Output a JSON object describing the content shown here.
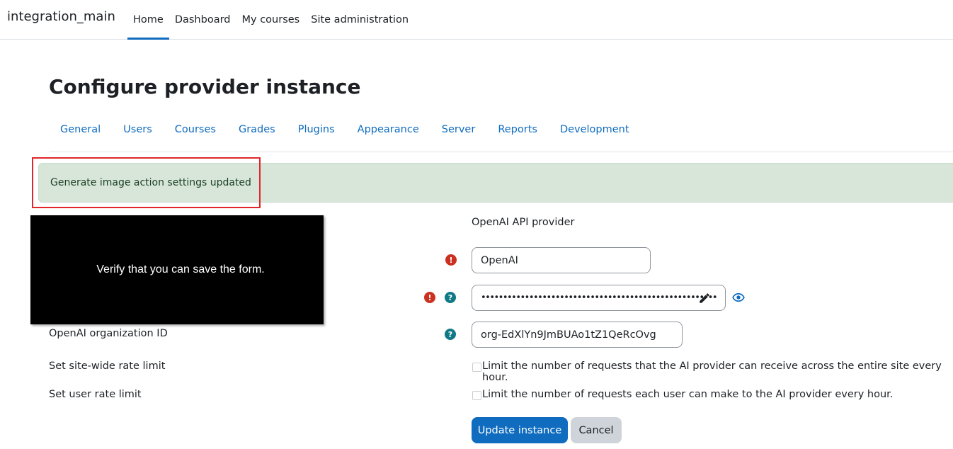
{
  "site": {
    "name": "integration_main"
  },
  "primary_nav": {
    "items": [
      {
        "label": "Home",
        "active": true
      },
      {
        "label": "Dashboard"
      },
      {
        "label": "My courses"
      },
      {
        "label": "Site administration"
      }
    ]
  },
  "page": {
    "title": "Configure provider instance"
  },
  "secondary_nav": {
    "tabs": [
      "General",
      "Users",
      "Courses",
      "Grades",
      "Plugins",
      "Appearance",
      "Server",
      "Reports",
      "Development"
    ]
  },
  "notification": {
    "message": "Generate image action settings updated"
  },
  "overlay": {
    "message": "Verify that you can save the form."
  },
  "form": {
    "provider_value": "OpenAI API provider",
    "instance_name_value": "OpenAI",
    "api_key_value": "•••••••••••••••••••••••••••••••••••••••••••••••••••••••",
    "org_id": {
      "label": "OpenAI organization ID",
      "value": "org-EdXlYn9JmBUAo1tZ1QeRcOvg"
    },
    "site_rate": {
      "label": "Set site-wide rate limit",
      "checkbox_label": "Limit the number of requests that the AI provider can receive across the entire site every hour."
    },
    "user_rate": {
      "label": "Set user rate limit",
      "checkbox_label": "Limit the number of requests each user can make to the AI provider every hour."
    }
  },
  "buttons": {
    "update": "Update instance",
    "cancel": "Cancel"
  },
  "icons": {
    "error": "exclamation-circle-icon",
    "help": "question-circle-icon",
    "edit": "pencil-icon",
    "reveal": "eye-icon"
  },
  "colors": {
    "primary": "#0f6cbf",
    "success_bg": "#d7e6d9",
    "error": "#ca3120",
    "help": "#0f7a86",
    "highlight": "#e0262b"
  }
}
